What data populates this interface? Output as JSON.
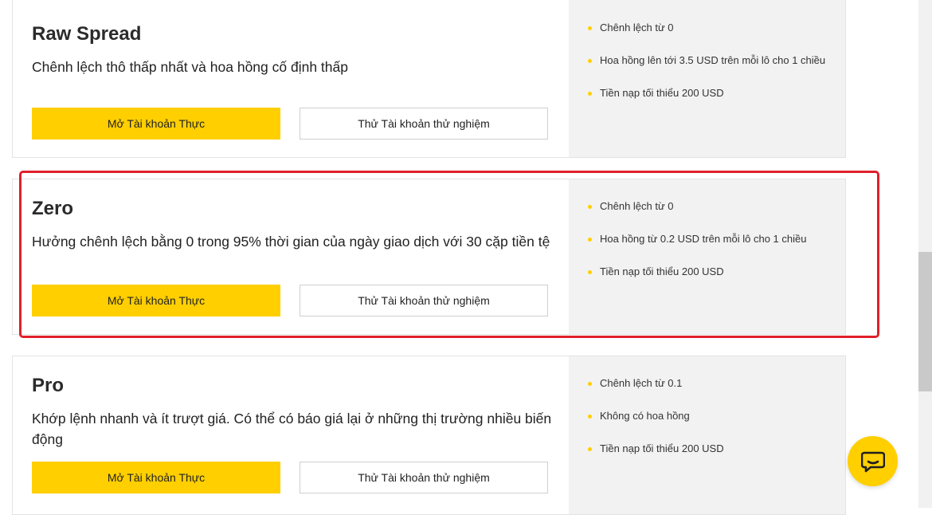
{
  "accounts": [
    {
      "title": "Raw Spread",
      "description": "Chênh lệch thô thấp nhất và hoa hồng cố định thấp",
      "primary_button": "Mở Tài khoản Thực",
      "secondary_button": "Thử Tài khoản thử nghiệm",
      "features": [
        "Chênh lệch từ 0",
        "Hoa hồng lên tới 3.5 USD trên mỗi lô cho 1 chiều",
        "Tiền nạp tối thiểu 200 USD"
      ]
    },
    {
      "title": "Zero",
      "description": "Hưởng chênh lệch bằng 0 trong 95% thời gian của ngày giao dịch với 30 cặp tiền tệ",
      "primary_button": "Mở Tài khoản Thực",
      "secondary_button": "Thử Tài khoản thử nghiệm",
      "features": [
        "Chênh lệch từ 0",
        "Hoa hồng từ 0.2 USD trên mỗi lô cho 1 chiều",
        "Tiền nạp tối thiểu 200 USD"
      ]
    },
    {
      "title": "Pro",
      "description": "Khớp lệnh nhanh và ít trượt giá. Có thể có báo giá lại ở những thị trường nhiều biến động",
      "primary_button": "Mở Tài khoản Thực",
      "secondary_button": "Thử Tài khoản thử nghiệm",
      "features": [
        "Chênh lệch từ 0.1",
        "Không có hoa hồng",
        "Tiền nạp tối thiểu 200 USD"
      ]
    }
  ],
  "colors": {
    "accent": "#ffcf00",
    "highlight_border": "#e0202a",
    "panel_bg": "#f2f2f2"
  },
  "icons": {
    "chat": "chat-bubble-icon",
    "bullet": "bullet-dot-icon"
  }
}
